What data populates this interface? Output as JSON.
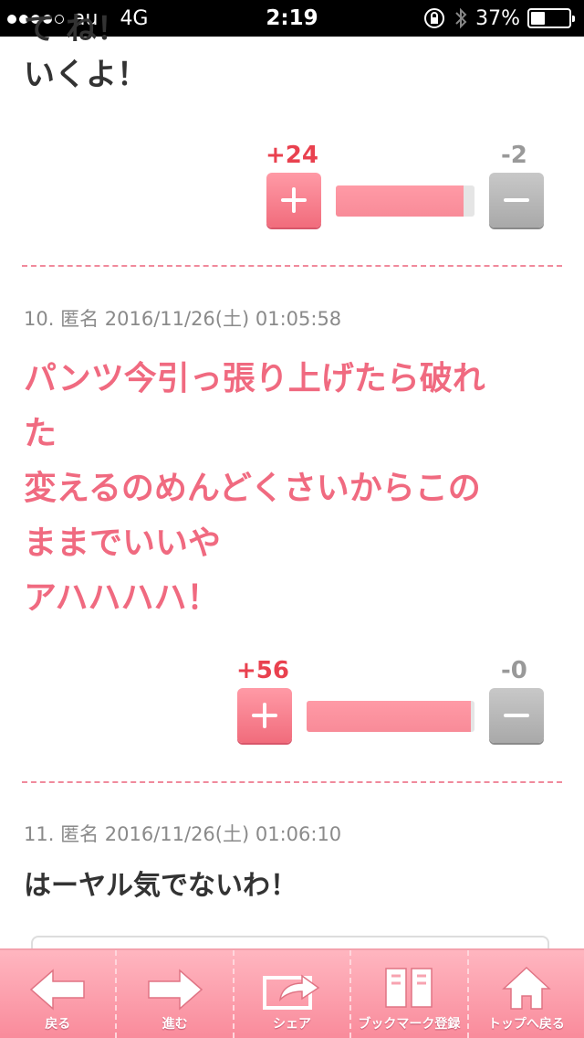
{
  "status": {
    "carrier": "au",
    "network": "4G",
    "time": "2:19",
    "battery": "37%",
    "battery_level": 0.37
  },
  "comments": [
    {
      "lines": [
        "て ね！",
        "いくよ！"
      ],
      "plus": "+24",
      "minus": "-2",
      "ratio": 0.92
    },
    {
      "meta": "10. 匿名 2016/11/26(土) 01:05:58",
      "lines": [
        "パンツ今引っ張り上げたら破れ",
        "た",
        "変えるのめんどくさいからこの",
        "ままでいいや",
        "アハハハハ！"
      ],
      "plus": "+56",
      "minus": "-0",
      "ratio": 0.98
    },
    {
      "meta": "11. 匿名 2016/11/26(土) 01:06:10",
      "lines": [
        "はーヤル気でないわ！"
      ]
    }
  ],
  "toolbar": {
    "back": "戻る",
    "forward": "進む",
    "share": "シェア",
    "bookmark": "ブックマーク登録",
    "top": "トップへ戻る"
  },
  "colors": {
    "accent": "#f06a80",
    "plus": "#e9414f",
    "minus": "#999999"
  }
}
